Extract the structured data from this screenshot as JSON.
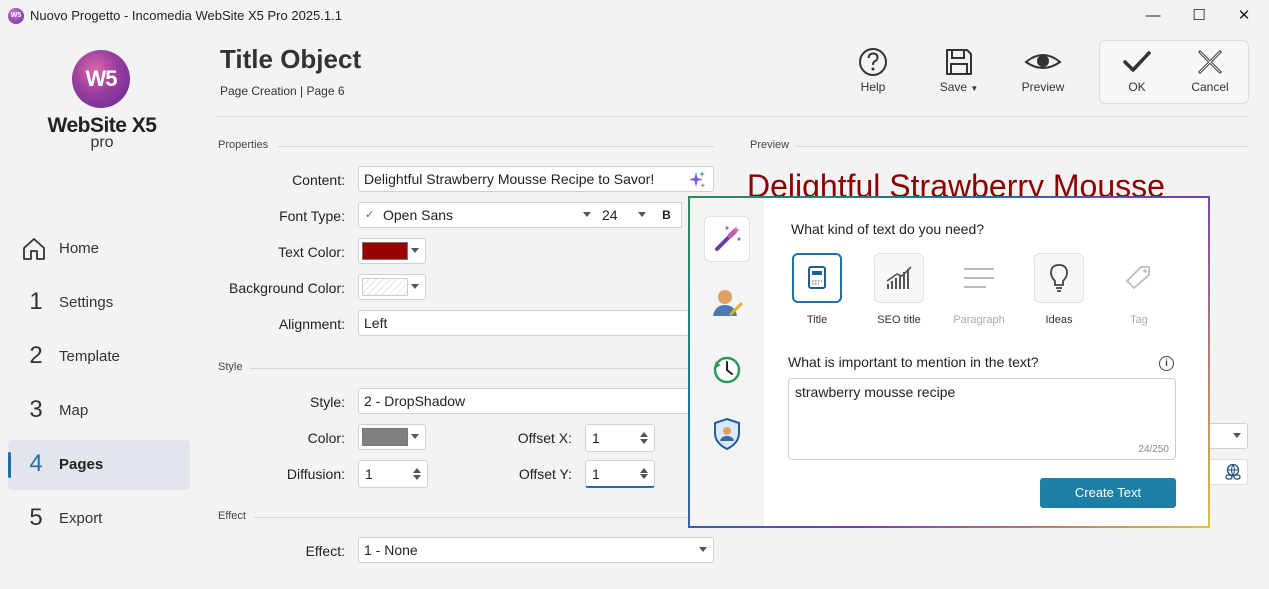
{
  "window": {
    "title": "Nuovo Progetto - Incomedia WebSite X5 Pro 2025.1.1",
    "app_icon_text": "W5",
    "minimize": "—",
    "maximize": "☐",
    "close": "✕"
  },
  "logo": {
    "mark": "W5",
    "name": "WebSite X5",
    "edition": "pro"
  },
  "nav": [
    {
      "num": "",
      "label": "Home"
    },
    {
      "num": "1",
      "label": "Settings"
    },
    {
      "num": "2",
      "label": "Template"
    },
    {
      "num": "3",
      "label": "Map"
    },
    {
      "num": "4",
      "label": "Pages"
    },
    {
      "num": "5",
      "label": "Export"
    }
  ],
  "header": {
    "title": "Title Object",
    "breadcrumb": "Page Creation | Page 6"
  },
  "toolbar": {
    "help": "Help",
    "save": "Save",
    "preview": "Preview",
    "ok": "OK",
    "cancel": "Cancel"
  },
  "sections": {
    "properties": "Properties",
    "style": "Style",
    "effect": "Effect",
    "preview": "Preview"
  },
  "properties": {
    "content_label": "Content:",
    "content_value": "Delightful Strawberry Mousse Recipe to Savor!",
    "font_label": "Font Type:",
    "font_value": "Open Sans",
    "font_size": "24",
    "bold": "B",
    "text_color_label": "Text Color:",
    "text_color": "#990000",
    "bg_color_label": "Background Color:",
    "alignment_label": "Alignment:",
    "alignment_value": "Left"
  },
  "style": {
    "style_label": "Style:",
    "style_value": "2 - DropShadow",
    "color_label": "Color:",
    "color_value": "#808080",
    "offset_x_label": "Offset X:",
    "offset_x": "1",
    "diffusion_label": "Diffusion:",
    "diffusion": "1",
    "offset_y_label": "Offset Y:",
    "offset_y": "1"
  },
  "effect": {
    "effect_label": "Effect:",
    "effect_value": "1 - None"
  },
  "preview": {
    "text": "Delightful Strawberry Mousse"
  },
  "ai": {
    "question": "What kind of text do you need?",
    "kinds": [
      {
        "label": "Title",
        "icon": "title-icon"
      },
      {
        "label": "SEO title",
        "icon": "seo-chart-icon"
      },
      {
        "label": "Paragraph",
        "icon": "paragraph-icon"
      },
      {
        "label": "Ideas",
        "icon": "lightbulb-icon"
      },
      {
        "label": "Tag",
        "icon": "tag-icon"
      }
    ],
    "mention_label": "What is important to mention in the text?",
    "info": "i",
    "input_value": "strawberry mousse recipe",
    "char_count": "24/250",
    "create_button": "Create Text"
  }
}
